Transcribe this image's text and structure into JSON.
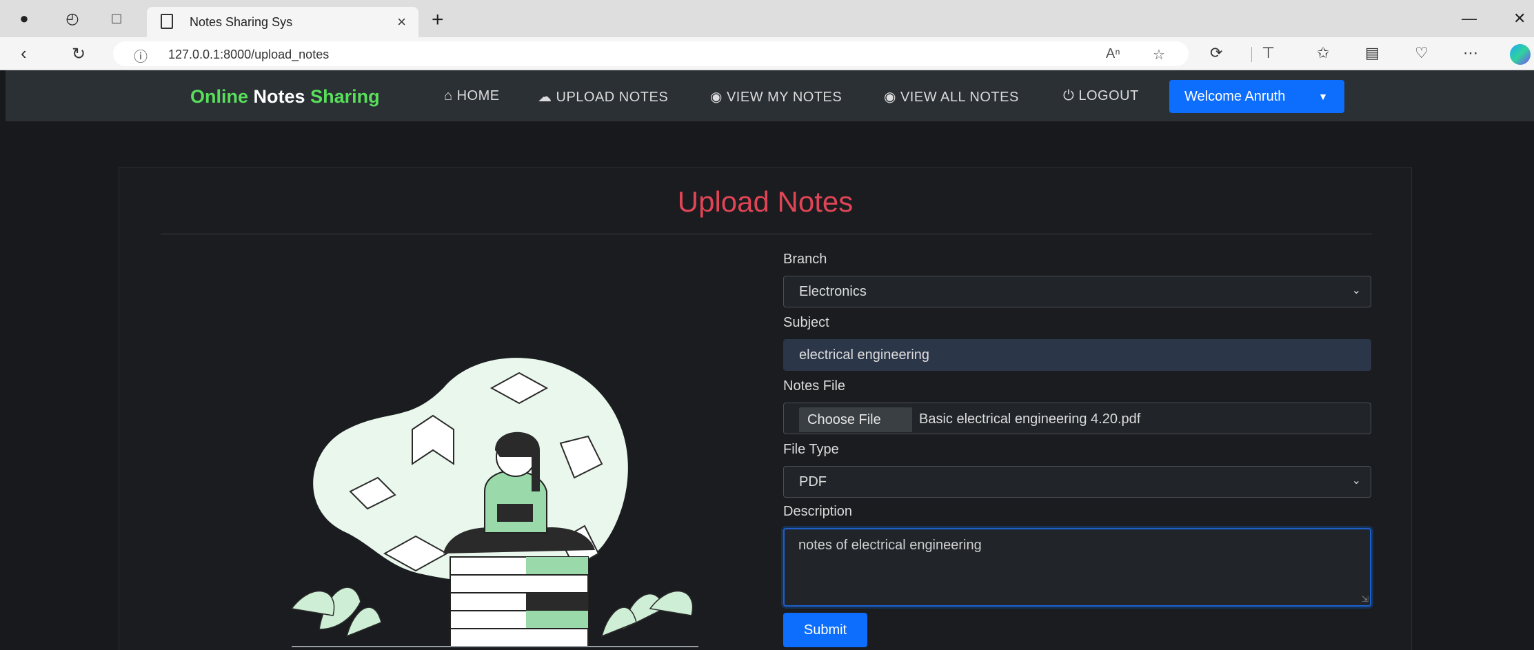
{
  "browser": {
    "tab_title": "Notes Sharing Sys",
    "tab_close": "×",
    "new_tab": "+",
    "url": "127.0.0.1:8000/upload_notes",
    "win_min": "—",
    "win_close": "✕"
  },
  "navbar": {
    "brand_part1": "Online",
    "brand_part2": "Notes",
    "brand_part3": "Sharing",
    "links": [
      {
        "icon": "home-icon",
        "label": "HOME"
      },
      {
        "icon": "cloud-upload-icon",
        "label": "UPLOAD NOTES"
      },
      {
        "icon": "eye-icon",
        "label": "VIEW MY NOTES"
      },
      {
        "icon": "eye-icon",
        "label": "VIEW ALL NOTES"
      },
      {
        "icon": "power-icon",
        "label": "LOGOUT"
      }
    ],
    "welcome": "Welcome Anruth"
  },
  "form": {
    "title": "Upload Notes",
    "branch_label": "Branch",
    "branch_value": "Electronics",
    "subject_label": "Subject",
    "subject_value": "electrical engineering",
    "notes_file_label": "Notes File",
    "choose_file_button": "Choose File",
    "file_name": "Basic electrical engineering 4.20.pdf",
    "file_type_label": "File Type",
    "file_type_value": "PDF",
    "description_label": "Description",
    "description_value": "notes of electrical engineering",
    "submit_label": "Submit"
  },
  "colors": {
    "brand_green": "#58e05a",
    "title_red": "#e04556",
    "primary_blue": "#0d6efd",
    "navbar_bg": "#2b3035",
    "page_bg": "#17191c"
  }
}
